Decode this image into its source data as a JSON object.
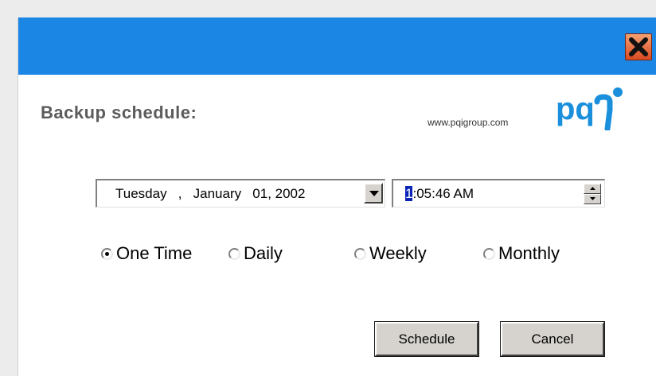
{
  "window": {
    "title_bar_color": "#1c86e5",
    "close_icon": "close-x-icon"
  },
  "header": {
    "title": "Backup schedule:",
    "url": "www.pqigroup.com",
    "logo_text": "pq",
    "logo_color": "#1a8fdc"
  },
  "date_picker": {
    "value": "Tuesday   ,   January   01, 2002",
    "dropdown_icon": "chevron-down-icon"
  },
  "time_picker": {
    "highlighted": "1",
    "rest": ":05:46 AM",
    "spin_up_icon": "spin-up-icon",
    "spin_down_icon": "spin-down-icon"
  },
  "frequency": {
    "selected": "One Time",
    "options": [
      {
        "label": "One Time",
        "checked": true
      },
      {
        "label": "Daily",
        "checked": false
      },
      {
        "label": "Weekly",
        "checked": false
      },
      {
        "label": "Monthly",
        "checked": false
      }
    ]
  },
  "buttons": {
    "schedule": "Schedule",
    "cancel": "Cancel"
  }
}
